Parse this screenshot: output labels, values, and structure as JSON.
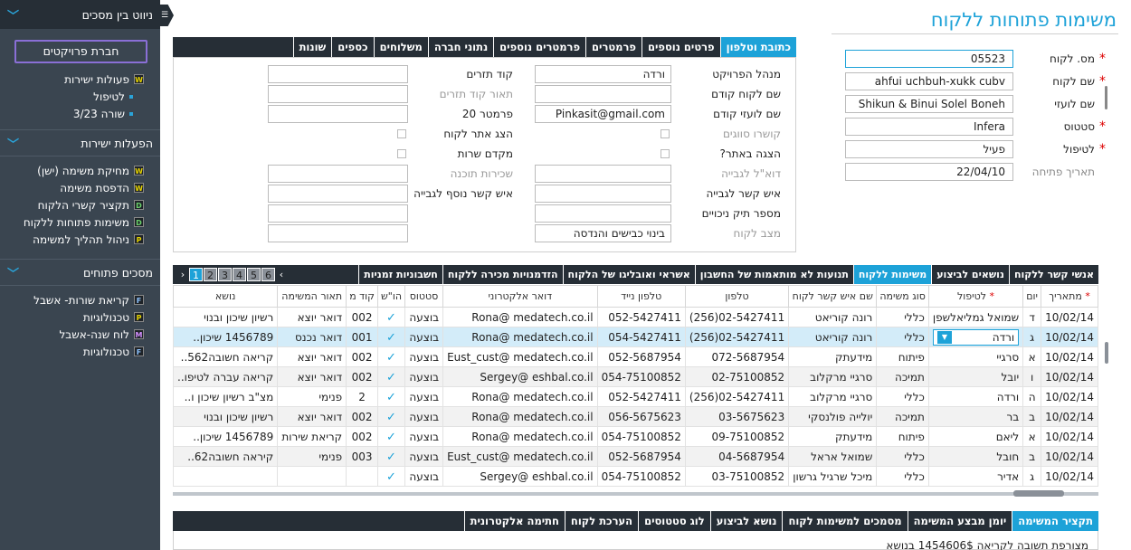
{
  "left_nav": {
    "header": "ניווט בין מסכים",
    "project_button": "חברת פרויקטים",
    "tree": [
      {
        "badge": "W",
        "label": "פעולות ישירות"
      },
      {
        "sub": true,
        "label": "לטיפול"
      },
      {
        "sub": true,
        "label": "שורה 3/23"
      }
    ],
    "section2": "הפעלות ישירות",
    "direct_actions": [
      {
        "badge": "W",
        "label": "מחיקת משימה (ישן)"
      },
      {
        "badge": "W",
        "label": "הדפסת משימה"
      },
      {
        "badge": "D",
        "label": "תקציר קשרי הלקוח"
      },
      {
        "badge": "D",
        "label": "משימות פתוחות ללקוח"
      },
      {
        "badge": "P",
        "label": "ניהול תהליך למשימה"
      }
    ],
    "section3": "מסכים פתוחים",
    "open_screens": [
      {
        "badge": "F",
        "label": "קריאת שורות- אשבל"
      },
      {
        "badge": "P",
        "label": "טכנולוגיות"
      },
      {
        "badge": "M",
        "label": "לוח שנה-אשבל"
      },
      {
        "badge": "F",
        "label": "טכנולוגיות"
      }
    ],
    "toggle_icon": "hamburger-icon"
  },
  "page_title": "משימות פתוחות ללקוח",
  "customer_fields": [
    {
      "label": "מס. לקוח",
      "value": "05523",
      "required": true,
      "active": true
    },
    {
      "label": "שם לקוח",
      "value": "ahfui uchbuh-xukk cubv",
      "required": true
    },
    {
      "label": "שם לועזי",
      "value": "Shikun & Binui Solel Boneh",
      "required": false
    },
    {
      "label": "סטטוס",
      "value": "Infera",
      "required": true
    },
    {
      "label": "לטיפול",
      "value": "פעיל",
      "required": true
    },
    {
      "label": "תאריך פתיחה",
      "value": "22/04/10",
      "required": false,
      "gray": true
    }
  ],
  "top_tabs": [
    "כתובת וטלפון",
    "פרטים נוספים",
    "פרמטרים",
    "פרמטרים נוספים",
    "נתוני חברה",
    "משלוחים",
    "כספים",
    "שונות"
  ],
  "form": {
    "col1": [
      {
        "label": "מנהל הפרויקט",
        "value": "ורדה"
      },
      {
        "label": "שם לקוח קודם",
        "value": ""
      },
      {
        "label": "שם לועזי קודם",
        "value": "Pinkasit@gmail.com"
      },
      {
        "label": "קושרו סווגים",
        "check": true,
        "gray": true
      },
      {
        "label": "הצגה באתר?",
        "check": true
      },
      {
        "label": "דוא\"ל לגבייה",
        "value": "",
        "gray": true
      },
      {
        "label": "איש קשר לגבייה",
        "value": ""
      },
      {
        "label": "מספר תיק ניכויים",
        "value": ""
      },
      {
        "label": "מצב לקוח",
        "value": "בינוי כבישים והנדסה",
        "gray": true
      }
    ],
    "col2": [
      {
        "label": "קוד תזרים",
        "value": ""
      },
      {
        "label": "תאור קוד תזרים",
        "value": "",
        "gray": true
      },
      {
        "label": "פרמטר 20",
        "value": ""
      },
      {
        "label": "הצג אתר לקוח",
        "check": true
      },
      {
        "label": "מקדם שרות",
        "check": true
      },
      {
        "label": "שכירות תוכנה",
        "value": "",
        "gray": true
      },
      {
        "label": "איש קשר נוסף לגבייה",
        "value": ""
      },
      {
        "label": "",
        "value": ""
      },
      {
        "label": "",
        "value": ""
      }
    ]
  },
  "grid_tabs": [
    "אנשי קשר ללקוח",
    "נושאים לביצוע",
    "משימות ללקוח",
    "תנועות לא מותאמות של החשבון",
    "אשראי ואובליגו של הלקוח",
    "הזדמנויות מכירה ללקוח",
    "חשבוניות זמניות"
  ],
  "pager": {
    "pages": [
      "1",
      "2",
      "3",
      "4",
      "5",
      "6"
    ],
    "current": "1",
    "prev": "‹",
    "next": "›"
  },
  "grid": {
    "columns": [
      "מתאריך",
      "יום",
      "לטיפול",
      "סוג משימה",
      "שם איש קשר לקוח",
      "טלפון",
      "טלפון נייד",
      "דואר אלקטרוני",
      "סטטוס",
      "הו\"ש",
      "קוד מ",
      "תאור המשימה",
      "נושא"
    ],
    "rows": [
      [
        "10/02/14",
        "ד",
        "שמואל גמליאלשפן",
        "כללי",
        "רונה קוריאט",
        "02-5427411(256)",
        "052-5427411",
        "Rona@ medatech.co.il",
        "בוצעה",
        "✓",
        "002",
        "דואר יוצא",
        "רשיון שיכון ובנוי"
      ],
      [
        "10/02/14",
        "ג",
        "ורדה",
        "כללי",
        "רונה קוריאט",
        "02-5427411(256)",
        "054-5427411",
        "Rona@ medatech.co.il",
        "בוצעה",
        "✓",
        "001",
        "דואר נכנס",
        "1456789 שיכון.."
      ],
      [
        "10/02/14",
        "א",
        "סרגיי",
        "פיתוח",
        "מידעתק",
        "072-5687954",
        "052-5687954",
        "Eust_cust@ medatech.co.il",
        "בוצעה",
        "✓",
        "002",
        "דואר יוצא",
        "קריאה חשובה562.."
      ],
      [
        "10/02/14",
        "ו",
        "יובל",
        "תמיכה",
        "סרגיי מרקלוב",
        "02-75100852",
        "054-75100852",
        "Sergey@ eshbal.co.il",
        "בוצעה",
        "✓",
        "002",
        "דואר יוצא",
        "קריאה עברה לטיפו.."
      ],
      [
        "10/02/14",
        "ה",
        "ורדה",
        "כללי",
        "סרגיי מרקלוב",
        "02-5427411(256)",
        "052-5427411",
        "Rona@ medatech.co.il",
        "בוצעה",
        "✓",
        "2",
        "פנימי",
        "מצ\"ב רשיון שיכון ו.."
      ],
      [
        "10/02/14",
        "ב",
        "בר",
        "תמיכה",
        "יולייה פולנסקי",
        "03-5675623",
        "056-5675623",
        "Rona@ medatech.co.il",
        "בוצעה",
        "✓",
        "002",
        "דואר יוצא",
        "רשיון שיכון ובנוי"
      ],
      [
        "10/02/14",
        "א",
        "ליאם",
        "פיתוח",
        "מידעתק",
        "09-75100852",
        "054-75100852",
        "Rona@ medatech.co.il",
        "בוצעה",
        "✓",
        "002",
        "קריאת שירות",
        "1456789 שיכון.."
      ],
      [
        "10/02/14",
        "ב",
        "חובל",
        "כללי",
        "שמואל אראל",
        "04-5687954",
        "052-5687954",
        "Eust_cust@ medatech.co.il",
        "בוצעה",
        "✓",
        "003",
        "פנימי",
        "קיראה חשובה62.."
      ],
      [
        "10/02/14",
        "ג",
        "אדיר",
        "כללי",
        "מיכל שרגיל גרשון",
        "03-75100852",
        "054-75100852",
        "Sergey@ eshbal.co.il",
        "בוצעה",
        "✓",
        "",
        "",
        ""
      ]
    ]
  },
  "bottom_tabs": [
    "תקציר המשימה",
    "יומן מבצע המשימה",
    "מסמכים למשימות לקוח",
    "נושא לביצוע",
    "לוג סטטוסים",
    "הערכת לקוח",
    "חתימה אלקטרונית"
  ],
  "bottom_text": "מצורפת תשובה לקריאה 1454606$ בנושא",
  "colors": {
    "accent": "#1da2d8",
    "nav_bg": "#3a4550",
    "tab_bg": "#262e36",
    "selected_row": "#d3ecf9"
  }
}
